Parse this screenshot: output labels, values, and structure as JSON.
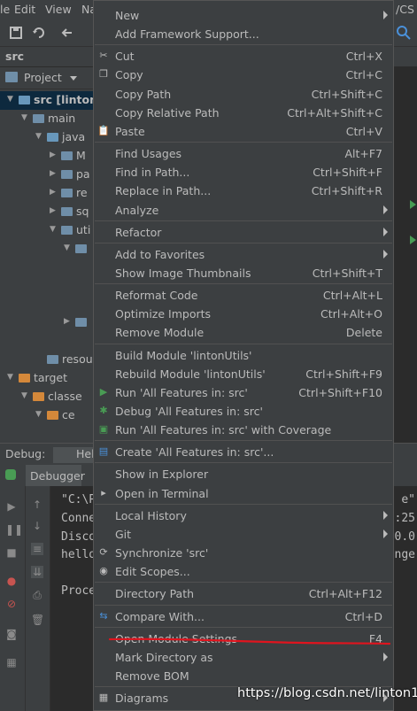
{
  "menubar": {
    "items": [
      "le",
      "Edit",
      "View",
      "Na",
      "/CS"
    ]
  },
  "navbar": {
    "crumb": "src",
    "editor_tab": "He"
  },
  "project_panel": {
    "title": "Project"
  },
  "tree": [
    {
      "label": "src [lintonU",
      "depth": 0,
      "expanded": true,
      "bold": true,
      "selected": true,
      "folder": "blue"
    },
    {
      "label": "main",
      "depth": 1,
      "expanded": true,
      "folder": "gray"
    },
    {
      "label": "java",
      "depth": 2,
      "expanded": true,
      "folder": "blue"
    },
    {
      "label": "M",
      "depth": 3,
      "expanded": false,
      "folder": "gray"
    },
    {
      "label": "pa",
      "depth": 3,
      "expanded": false,
      "folder": "gray"
    },
    {
      "label": "re",
      "depth": 3,
      "expanded": false,
      "folder": "gray"
    },
    {
      "label": "sq",
      "depth": 3,
      "expanded": false,
      "folder": "gray"
    },
    {
      "label": "uti",
      "depth": 3,
      "expanded": true,
      "folder": "gray"
    },
    {
      "label": "",
      "depth": 4,
      "expanded": true,
      "folder": "gray"
    },
    {
      "label": "",
      "depth": 4,
      "expanded": false,
      "folder": "gray"
    },
    {
      "label": "resou",
      "depth": 2,
      "expanded": null,
      "folder": "gray"
    },
    {
      "label": "target",
      "depth": 0,
      "expanded": true,
      "folder": "orange"
    },
    {
      "label": "classe",
      "depth": 1,
      "expanded": true,
      "folder": "orange"
    },
    {
      "label": "ce",
      "depth": 2,
      "expanded": true,
      "folder": "orange"
    }
  ],
  "debug": {
    "title": "Debug:",
    "tab": "Hel",
    "debugger_tab": "Debugger"
  },
  "console": {
    "lines": [
      "\"C:\\P",
      "Conne",
      "Disco",
      "hello",
      "",
      "Proce"
    ],
    "right_frag": [
      "e\"",
      ":25",
      "0.0",
      "inge"
    ]
  },
  "context_menu": {
    "groups": [
      [
        {
          "label": "New",
          "icon": "",
          "shortcut": "",
          "submenu": true
        },
        {
          "label": "Add Framework Support...",
          "icon": "",
          "shortcut": "",
          "submenu": false
        }
      ],
      [
        {
          "label": "Cut",
          "icon": "scissors-icon",
          "shortcut": "Ctrl+X",
          "submenu": false
        },
        {
          "label": "Copy",
          "icon": "copy-icon",
          "shortcut": "Ctrl+C",
          "submenu": false
        },
        {
          "label": "Copy Path",
          "icon": "",
          "shortcut": "Ctrl+Shift+C",
          "submenu": false
        },
        {
          "label": "Copy Relative Path",
          "icon": "",
          "shortcut": "Ctrl+Alt+Shift+C",
          "submenu": false
        },
        {
          "label": "Paste",
          "icon": "clipboard-icon",
          "shortcut": "Ctrl+V",
          "submenu": false
        }
      ],
      [
        {
          "label": "Find Usages",
          "icon": "",
          "shortcut": "Alt+F7",
          "submenu": false
        },
        {
          "label": "Find in Path...",
          "icon": "",
          "shortcut": "Ctrl+Shift+F",
          "submenu": false
        },
        {
          "label": "Replace in Path...",
          "icon": "",
          "shortcut": "Ctrl+Shift+R",
          "submenu": false
        },
        {
          "label": "Analyze",
          "icon": "",
          "shortcut": "",
          "submenu": true
        }
      ],
      [
        {
          "label": "Refactor",
          "icon": "",
          "shortcut": "",
          "submenu": true
        }
      ],
      [
        {
          "label": "Add to Favorites",
          "icon": "",
          "shortcut": "",
          "submenu": true
        },
        {
          "label": "Show Image Thumbnails",
          "icon": "",
          "shortcut": "Ctrl+Shift+T",
          "submenu": false
        }
      ],
      [
        {
          "label": "Reformat Code",
          "icon": "",
          "shortcut": "Ctrl+Alt+L",
          "submenu": false
        },
        {
          "label": "Optimize Imports",
          "icon": "",
          "shortcut": "Ctrl+Alt+O",
          "submenu": false
        },
        {
          "label": "Remove Module",
          "icon": "",
          "shortcut": "Delete",
          "submenu": false
        }
      ],
      [
        {
          "label": "Build Module 'lintonUtils'",
          "icon": "",
          "shortcut": "",
          "submenu": false
        },
        {
          "label": "Rebuild Module 'lintonUtils'",
          "icon": "",
          "shortcut": "Ctrl+Shift+F9",
          "submenu": false
        },
        {
          "label": "Run 'All Features in: src'",
          "icon": "run-icon",
          "shortcut": "Ctrl+Shift+F10",
          "submenu": false
        },
        {
          "label": "Debug 'All Features in: src'",
          "icon": "debug-icon",
          "shortcut": "",
          "submenu": false
        },
        {
          "label": "Run 'All Features in: src' with Coverage",
          "icon": "coverage-icon",
          "shortcut": "",
          "submenu": false
        }
      ],
      [
        {
          "label": "Create 'All Features in: src'...",
          "icon": "create-config-icon",
          "shortcut": "",
          "submenu": false
        }
      ],
      [
        {
          "label": "Show in Explorer",
          "icon": "",
          "shortcut": "",
          "submenu": false
        },
        {
          "label": "Open in Terminal",
          "icon": "terminal-icon",
          "shortcut": "",
          "submenu": false
        }
      ],
      [
        {
          "label": "Local History",
          "icon": "",
          "shortcut": "",
          "submenu": true
        },
        {
          "label": "Git",
          "icon": "",
          "shortcut": "",
          "submenu": true
        },
        {
          "label": "Synchronize 'src'",
          "icon": "sync-icon",
          "shortcut": "",
          "submenu": false
        },
        {
          "label": "Edit Scopes...",
          "icon": "scope-icon",
          "shortcut": "",
          "submenu": false
        }
      ],
      [
        {
          "label": "Directory Path",
          "icon": "",
          "shortcut": "Ctrl+Alt+F12",
          "submenu": false
        }
      ],
      [
        {
          "label": "Compare With...",
          "icon": "compare-icon",
          "shortcut": "Ctrl+D",
          "submenu": false
        }
      ],
      [
        {
          "label": "Open Module Settings",
          "icon": "",
          "shortcut": "F4",
          "submenu": false,
          "highlight": true
        },
        {
          "label": "Mark Directory as",
          "icon": "",
          "shortcut": "",
          "submenu": true
        },
        {
          "label": "Remove BOM",
          "icon": "",
          "shortcut": "",
          "submenu": false
        }
      ],
      [
        {
          "label": "Diagrams",
          "icon": "diagram-icon",
          "shortcut": "",
          "submenu": true
        }
      ]
    ]
  },
  "watermark": "https://blog.csdn.net/linton1",
  "colors": {
    "menu_bg": "#3c3f41",
    "text": "#bbbbbb",
    "annotation_red": "#e0141e",
    "run_green": "#499c54"
  }
}
